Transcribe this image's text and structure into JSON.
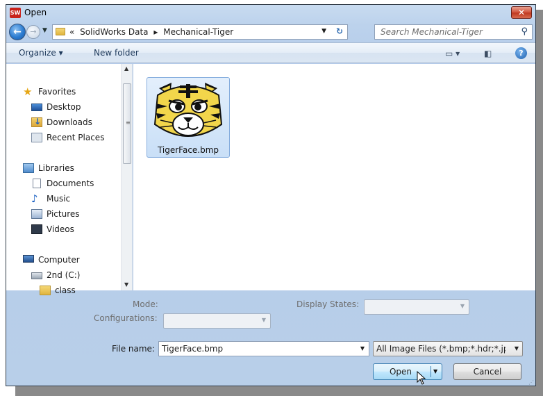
{
  "window": {
    "app_icon_text": "SW",
    "title": "Open",
    "close_label": "✕"
  },
  "navbar": {
    "breadcrumb_overflow": "«",
    "breadcrumbs": [
      "SolidWorks Data",
      "Mechanical-Tiger"
    ],
    "separator": "▸",
    "search_placeholder": "Search Mechanical-Tiger"
  },
  "toolbar": {
    "organize_label": "Organize ▾",
    "new_folder_label": "New folder",
    "help_label": "?"
  },
  "sidebar": {
    "items": [
      {
        "label": "Favorites",
        "icon": "star-icon"
      },
      {
        "label": "Desktop",
        "icon": "desktop-icon"
      },
      {
        "label": "Downloads",
        "icon": "downloads-icon"
      },
      {
        "label": "Recent Places",
        "icon": "recent-places-icon"
      },
      {
        "label": "Libraries",
        "icon": "libraries-icon"
      },
      {
        "label": "Documents",
        "icon": "documents-icon"
      },
      {
        "label": "Music",
        "icon": "music-icon"
      },
      {
        "label": "Pictures",
        "icon": "pictures-icon"
      },
      {
        "label": "Videos",
        "icon": "videos-icon"
      },
      {
        "label": "Computer",
        "icon": "computer-icon"
      },
      {
        "label": "2nd (C:)",
        "icon": "drive-icon"
      },
      {
        "label": "class",
        "icon": "folder-icon"
      }
    ]
  },
  "files": [
    {
      "name": "TigerFace.bmp",
      "selected": true
    }
  ],
  "options": {
    "mode_label": "Mode:",
    "configurations_label": "Configurations:",
    "display_states_label": "Display States:"
  },
  "file_name": {
    "label": "File name:",
    "value": "TigerFace.bmp"
  },
  "file_type": {
    "value": "All Image Files (*.bmp;*.hdr;*.jpg"
  },
  "buttons": {
    "open_label": "Open",
    "cancel_label": "Cancel"
  },
  "colors": {
    "accent": "#3c7fb1",
    "window_chrome": "#b9d0ea",
    "selection": "#cce3f8"
  }
}
